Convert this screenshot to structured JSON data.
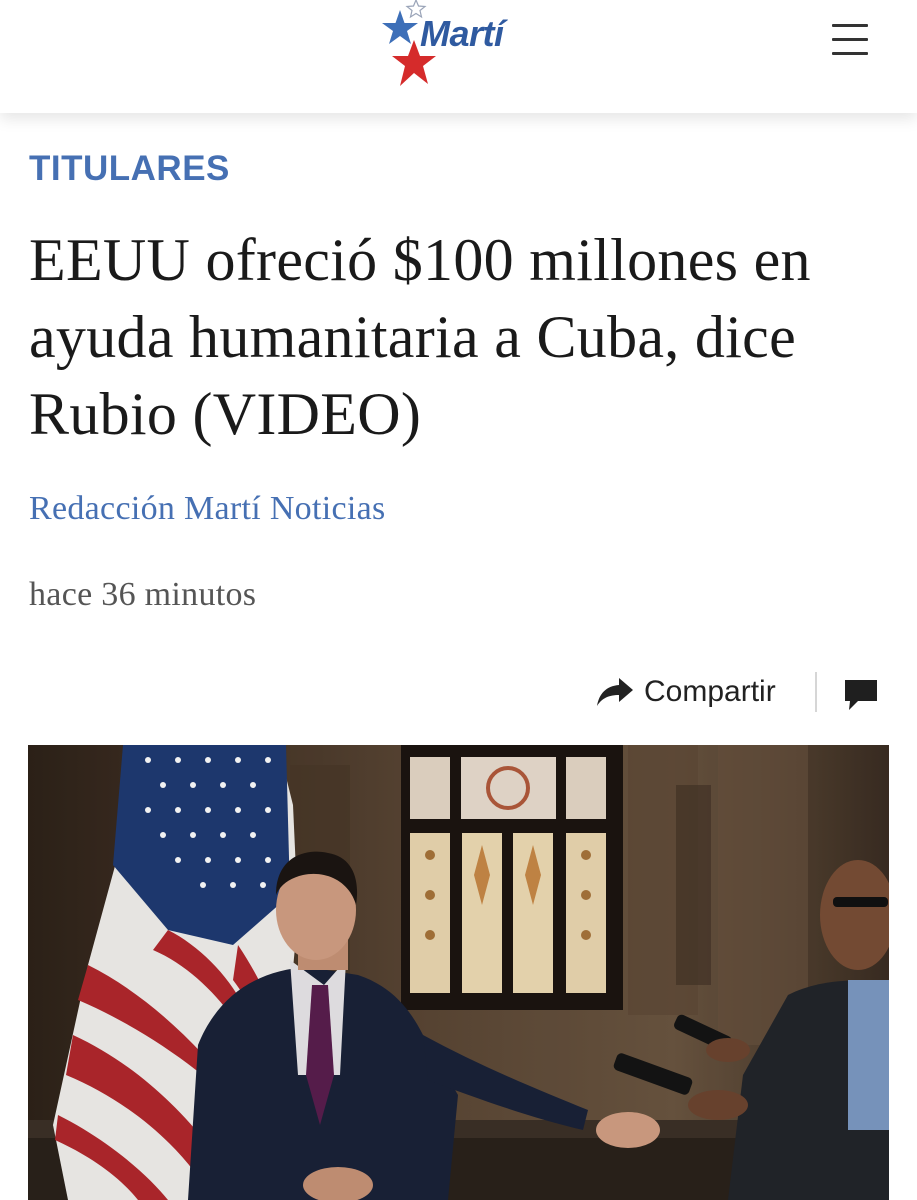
{
  "header": {
    "logo_text": "Martí",
    "logo_icon": "star-icon",
    "menu_icon": "hamburger-menu-icon"
  },
  "article": {
    "category": "TITULARES",
    "headline": "EEUU ofreció $100 millones en ayuda humanitaria a Cuba, dice Rubio (VIDEO)",
    "author": "Redacción Martí Noticias",
    "timestamp": "hace 36 minutos"
  },
  "actions": {
    "share_label": "Compartir",
    "share_icon": "share-arrow-icon",
    "comment_icon": "comment-icon"
  },
  "colors": {
    "accent_blue": "#4670b3",
    "logo_blue": "#2f5aa0",
    "logo_red": "#d52b2b",
    "headline": "#1a1a1a",
    "meta_gray": "#555555"
  }
}
